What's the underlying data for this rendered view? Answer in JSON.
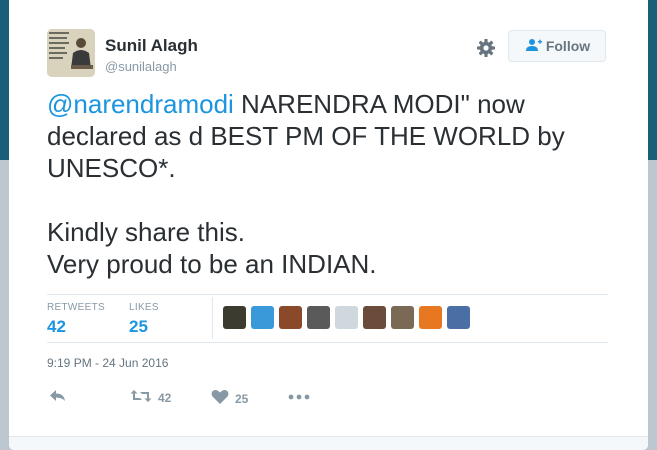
{
  "user": {
    "name": "Sunil Alagh",
    "handle": "@sunilalagh"
  },
  "follow_label": "Follow",
  "tweet": {
    "mention": "@narendramodi",
    "text_after_mention": " NARENDRA MODI\" now declared as d BEST PM OF THE WORLD by UNESCO*.\n\nKindly share this.\nVery proud to be an INDIAN."
  },
  "stats": {
    "retweets_label": "RETWEETS",
    "retweets_value": "42",
    "likes_label": "LIKES",
    "likes_value": "25"
  },
  "liker_avatars": [
    "avatar-1",
    "avatar-2",
    "avatar-3",
    "avatar-4",
    "avatar-5",
    "avatar-6",
    "avatar-7",
    "avatar-8",
    "avatar-9"
  ],
  "liker_colors": [
    "#3b3b2f",
    "#3a9ad9",
    "#8a4a2a",
    "#5a5a5a",
    "#cfd8dc",
    "#6b4c3b",
    "#7a6a55",
    "#e87722",
    "#4a6fa5"
  ],
  "timestamp": "9:19 PM - 24 Jun 2016",
  "actions": {
    "retweet_count": "42",
    "like_count": "25"
  },
  "icons": {
    "settings": "gear-icon",
    "follow": "add-user-icon",
    "reply": "reply-icon",
    "retweet": "retweet-icon",
    "like": "heart-icon",
    "more": "more-icon"
  },
  "colors": {
    "accent": "#1b95e0",
    "header_bg": "#1b5e7a"
  }
}
